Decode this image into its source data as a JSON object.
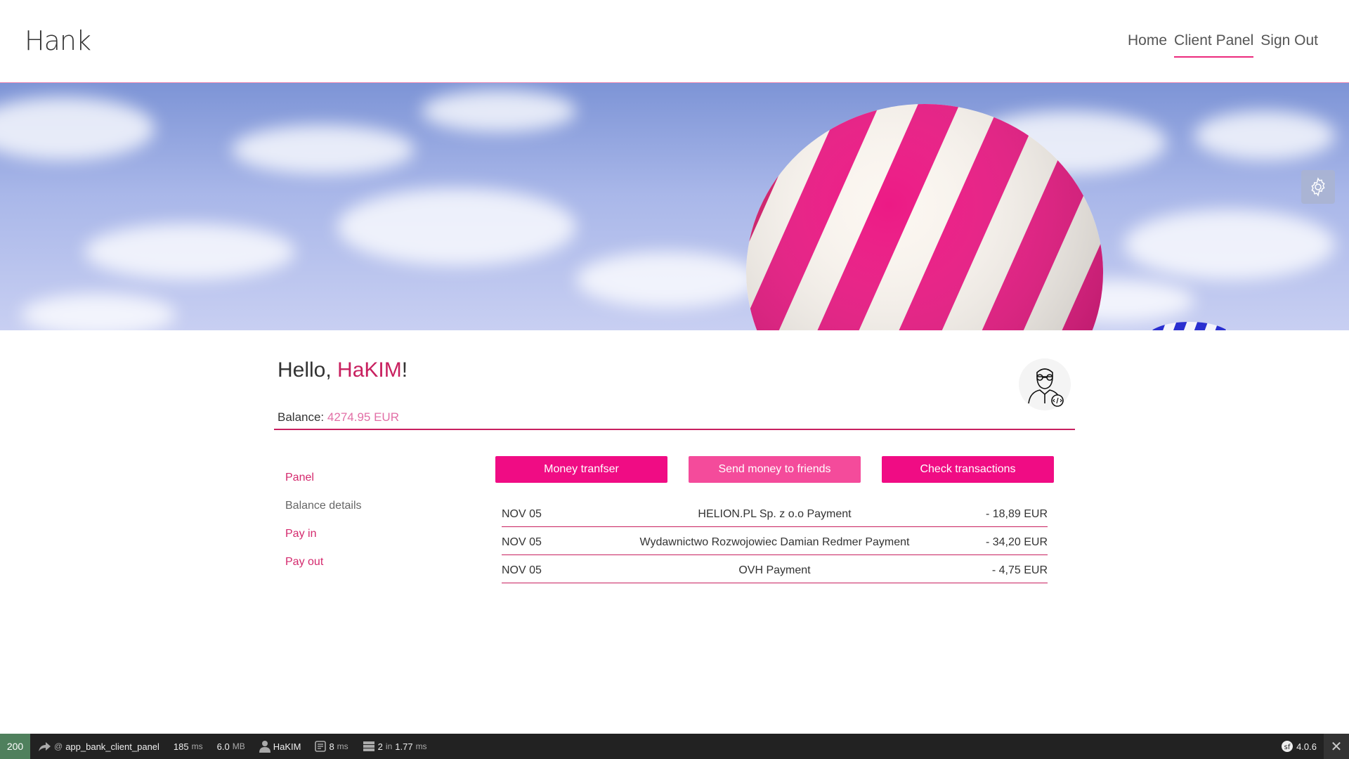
{
  "brand": "Hank",
  "nav": [
    {
      "label": "Home",
      "active": false
    },
    {
      "label": "Client Panel",
      "active": true
    },
    {
      "label": "Sign Out",
      "active": false
    }
  ],
  "hero": {
    "gear_icon": "gear-icon"
  },
  "greeting": {
    "prefix": "Hello, ",
    "name": "HaKIM",
    "suffix": "!"
  },
  "balance": {
    "label": "Balance:",
    "value": "4274.95 EUR"
  },
  "sidebar": [
    {
      "label": "Panel"
    },
    {
      "label": "Balance details"
    },
    {
      "label": "Pay in"
    },
    {
      "label": "Pay out"
    }
  ],
  "buttons": [
    {
      "label": "Money tranfser"
    },
    {
      "label": "Send money to friends"
    },
    {
      "label": "Check transactions"
    }
  ],
  "transactions": [
    {
      "date": "NOV 05",
      "description": "HELION.PL Sp. z o.o Payment",
      "amount": "- 18,89 EUR"
    },
    {
      "date": "NOV 05",
      "description": "Wydawnictwo Rozwojowiec Damian Redmer Payment",
      "amount": "- 34,20 EUR"
    },
    {
      "date": "NOV 05",
      "description": "OVH Payment",
      "amount": "- 4,75 EUR"
    }
  ],
  "toolbar": {
    "status": "200",
    "route_prefix": "@",
    "route": "app_bank_client_panel",
    "time_value": "185",
    "time_unit": "ms",
    "memory_value": "6.0",
    "memory_unit": "MB",
    "user": "HaKIM",
    "twig_value": "8",
    "twig_unit": "ms",
    "db_count": "2",
    "db_in": "in",
    "db_time": "1.77",
    "db_unit": "ms",
    "version": "4.0.6"
  },
  "colors": {
    "accent": "#ec2a7d",
    "button": "#f00c84",
    "button_light": "#f44b9b",
    "balance_value": "#e26fa6"
  }
}
